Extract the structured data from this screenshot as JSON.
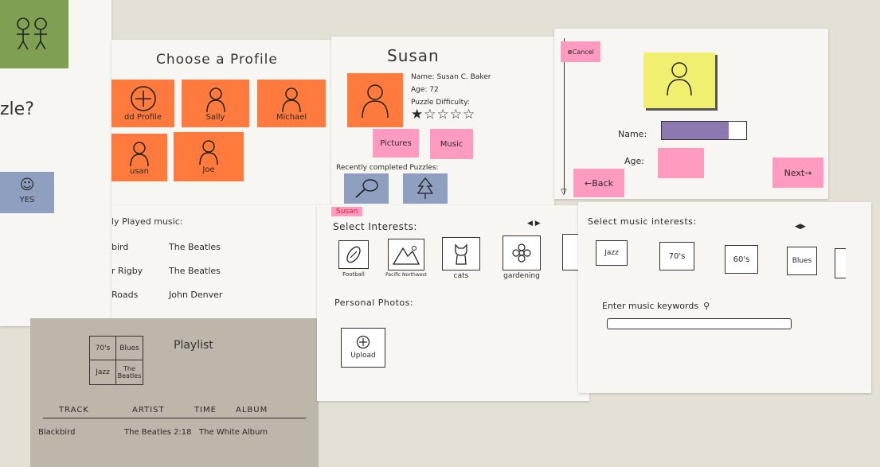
{
  "left_strip": {
    "question": "zle?",
    "yes_label": "YES"
  },
  "profile": {
    "title": "Choose a Profile",
    "tiles": [
      {
        "label": "dd Profile",
        "icon": "plus-icon"
      },
      {
        "label": "Sally",
        "icon": "person-icon"
      },
      {
        "label": "Michael",
        "icon": "person-icon"
      },
      {
        "label": "usan",
        "icon": "person-icon"
      },
      {
        "label": "Joe",
        "icon": "person-icon"
      }
    ]
  },
  "recent_music": {
    "header": "ly Played music:",
    "rows": [
      {
        "song": "bird",
        "artist": "The Beatles"
      },
      {
        "song": "r Rigby",
        "artist": "The Beatles"
      },
      {
        "song": "Roads",
        "artist": "John Denver"
      }
    ]
  },
  "playlist": {
    "title": "Playlist",
    "grid": [
      "70's",
      "Blues",
      "Jazz",
      "The Beatles"
    ],
    "columns": [
      "TRACK",
      "ARTIST",
      "TIME",
      "ALBUM"
    ],
    "rows": [
      {
        "track": "Blackbird",
        "artist": "The Beatles",
        "time": "2:18",
        "album": "The White Album"
      }
    ]
  },
  "susan_profile": {
    "title": "Susan",
    "name_line": "Name: Susan C. Baker",
    "age_line": "Age: 72",
    "difficulty_label": "Puzzle Difficulty:",
    "difficulty_rating": 1,
    "difficulty_max": 5,
    "pictures_label": "Pictures",
    "music_label": "Music",
    "recent_label": "Recently completed Puzzles:"
  },
  "new_profile": {
    "cancel_label": "⊗Cancel",
    "name_label": "Name:",
    "age_label": "Age:",
    "back_label": "←Back",
    "next_label": "Next→"
  },
  "interests": {
    "tag": "Susan",
    "header": "Select Interests:",
    "items": [
      {
        "label": "Football",
        "icon": "football-icon"
      },
      {
        "label": "Pacific Northwest",
        "icon": "mountain-icon"
      },
      {
        "label": "cats",
        "icon": "cat-icon"
      },
      {
        "label": "gardening",
        "icon": "flower-icon"
      }
    ],
    "photos_header": "Personal Photos:",
    "upload_label": "Upload"
  },
  "music_interests": {
    "header": "Select music interests:",
    "items": [
      "Jazz",
      "70's",
      "60's",
      "Blues"
    ],
    "search_label": "Enter music keywords"
  },
  "colors": {
    "orange": "#ff7a3c",
    "pink": "#ff9ac0",
    "blue": "#8e9fc0",
    "green": "#7fa052",
    "yellow": "#f1ef70",
    "purple": "#8d78b0"
  }
}
